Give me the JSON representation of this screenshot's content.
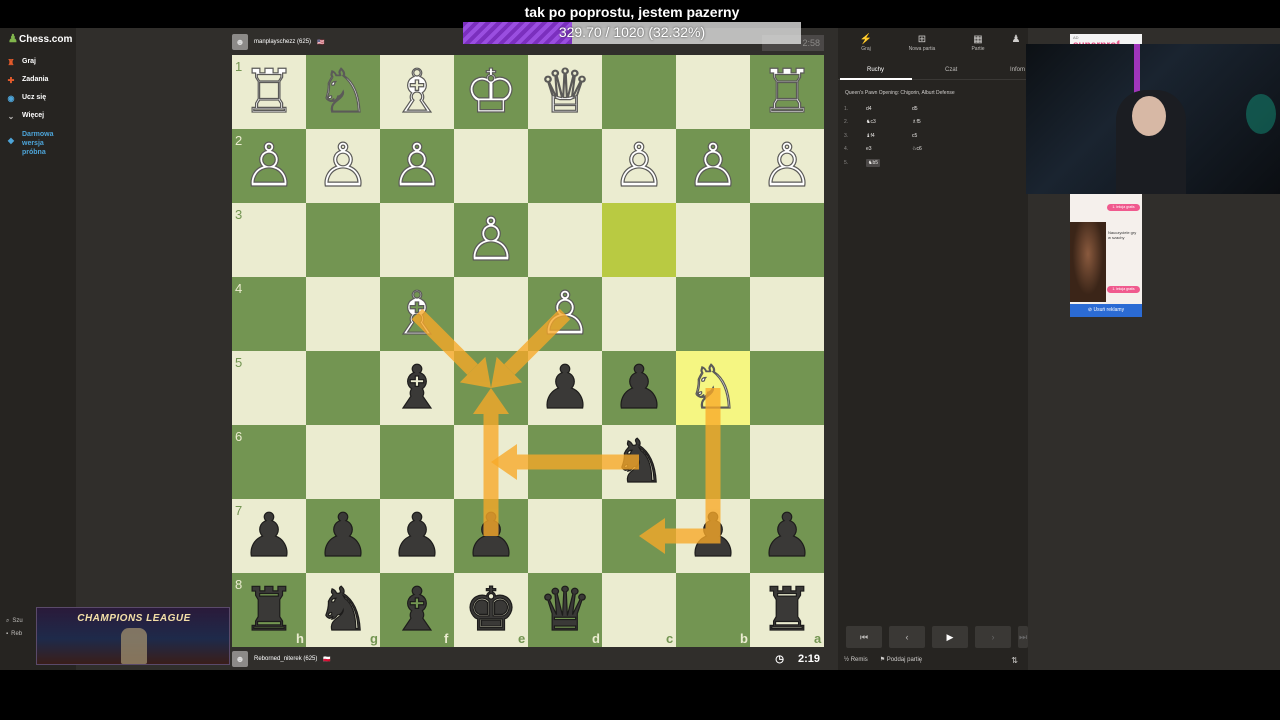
{
  "stream": {
    "title": "tak po poprostu, jestem pazerny",
    "progress_text": "329.70 / 1020 (32.32%)",
    "progress_fraction": 0.3232
  },
  "sidebar": {
    "brand": "Chess.com",
    "items": [
      {
        "label": "Graj",
        "icon": "play-icon",
        "color": "#e45b2b"
      },
      {
        "label": "Zadania",
        "icon": "puzzle-icon",
        "color": "#e45b2b"
      },
      {
        "label": "Ucz się",
        "icon": "learn-icon",
        "color": "#4da4d8"
      },
      {
        "label": "Więcej",
        "icon": "chevron-down-icon",
        "color": "#bdbbb9"
      },
      {
        "label": "Darmowa wersja próbna",
        "icon": "diamond-icon",
        "color": "#4da4d8"
      }
    ],
    "bottom_search": "Szu",
    "bottom_user": "Reb"
  },
  "top_player": {
    "name": "manplayschezz (625)",
    "flag": "🇺🇸",
    "clock": "2:58"
  },
  "bottom_player": {
    "name": "Reborned_niterek (625)",
    "flag": "🇵🇱",
    "clock": "2:19"
  },
  "board": {
    "rank_labels": [
      "1",
      "2",
      "3",
      "4",
      "5",
      "6",
      "7",
      "8"
    ],
    "file_labels": [
      "h",
      "g",
      "f",
      "e",
      "d",
      "c",
      "b",
      "a"
    ],
    "light_color": "#ebecd0",
    "dark_color": "#739552",
    "highlight_from": "#b9ca42",
    "highlight_to": "#f5f682",
    "arrow_color": "#f8a928",
    "pieces": [
      {
        "sq": "h1",
        "p": "♖",
        "c": "w"
      },
      {
        "sq": "g1",
        "p": "♘",
        "c": "w"
      },
      {
        "sq": "f1",
        "p": "♗",
        "c": "w"
      },
      {
        "sq": "e1",
        "p": "♔",
        "c": "w"
      },
      {
        "sq": "d1",
        "p": "♕",
        "c": "w"
      },
      {
        "sq": "a1",
        "p": "♖",
        "c": "w"
      },
      {
        "sq": "h2",
        "p": "♙",
        "c": "w"
      },
      {
        "sq": "g2",
        "p": "♙",
        "c": "w"
      },
      {
        "sq": "f2",
        "p": "♙",
        "c": "w"
      },
      {
        "sq": "c2",
        "p": "♙",
        "c": "w"
      },
      {
        "sq": "b2",
        "p": "♙",
        "c": "w"
      },
      {
        "sq": "a2",
        "p": "♙",
        "c": "w"
      },
      {
        "sq": "e3",
        "p": "♙",
        "c": "w"
      },
      {
        "sq": "f4",
        "p": "♗",
        "c": "w"
      },
      {
        "sq": "d4",
        "p": "♙",
        "c": "w"
      },
      {
        "sq": "f5",
        "p": "♝",
        "c": "b"
      },
      {
        "sq": "d5",
        "p": "♟",
        "c": "b"
      },
      {
        "sq": "c5",
        "p": "♟",
        "c": "b"
      },
      {
        "sq": "b5",
        "p": "♘",
        "c": "w"
      },
      {
        "sq": "c6",
        "p": "♞",
        "c": "b"
      },
      {
        "sq": "h7",
        "p": "♟",
        "c": "b"
      },
      {
        "sq": "g7",
        "p": "♟",
        "c": "b"
      },
      {
        "sq": "f7",
        "p": "♟",
        "c": "b"
      },
      {
        "sq": "e7",
        "p": "♟",
        "c": "b"
      },
      {
        "sq": "b7",
        "p": "♟",
        "c": "b"
      },
      {
        "sq": "a7",
        "p": "♟",
        "c": "b"
      },
      {
        "sq": "h8",
        "p": "♜",
        "c": "b"
      },
      {
        "sq": "g8",
        "p": "♞",
        "c": "b"
      },
      {
        "sq": "f8",
        "p": "♝",
        "c": "b"
      },
      {
        "sq": "e8",
        "p": "♚",
        "c": "b"
      },
      {
        "sq": "d8",
        "p": "♛",
        "c": "b"
      },
      {
        "sq": "a8",
        "p": "♜",
        "c": "b"
      }
    ],
    "last_move_from": "c3",
    "last_move_to": "b5",
    "arrows": [
      {
        "from": "f4",
        "to": "e5"
      },
      {
        "from": "d4",
        "to": "e5"
      },
      {
        "from": "e7",
        "to": "e5"
      },
      {
        "from": "c6",
        "to": "e6"
      },
      {
        "from": "b5",
        "to": "c7"
      }
    ]
  },
  "panel": {
    "actions": [
      {
        "label": "Graj",
        "icon": "play-icon"
      },
      {
        "label": "Nowa partia",
        "icon": "plus-icon"
      },
      {
        "label": "Partie",
        "icon": "board-icon"
      },
      {
        "label": "",
        "icon": "friends-icon"
      }
    ],
    "tabs": [
      "Ruchy",
      "Czat",
      "Infom"
    ],
    "opening": "Queen's Pawn Opening: Chigorin, Alburt Defense",
    "moves": [
      {
        "n": "1.",
        "w": "d4",
        "b": "d5"
      },
      {
        "n": "2.",
        "w": "♞c3",
        "b": "♗f5"
      },
      {
        "n": "3.",
        "w": "♝f4",
        "b": "c5"
      },
      {
        "n": "4.",
        "w": "e3",
        "b": "♘c6"
      },
      {
        "n": "5.",
        "w": "♞b5",
        "b": ""
      }
    ],
    "draw_label": "Remis",
    "resign_label": "Poddaj partię"
  },
  "ads": {
    "top_label": "AD",
    "top_brand": "superprof",
    "side_text": "Nauczyciele gry w szachy",
    "side_button": "1. lekcja gratis",
    "remove": "Usuń reklamy"
  },
  "overlay": {
    "champions": "CHAMPIONS LEAGUE"
  }
}
